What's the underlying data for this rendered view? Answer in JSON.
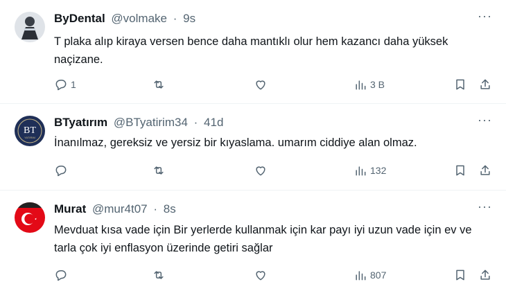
{
  "tweets": [
    {
      "name": "ByDental",
      "handle": "@volmake",
      "time": "9s",
      "text": "T plaka alıp kiraya versen bence daha mantıklı olur hem kazancı daha yüksek naçizane.",
      "replies": "1",
      "retweets": "",
      "likes": "",
      "views": "3 B"
    },
    {
      "name": "BTyatırım",
      "handle": "@BTyatirim34",
      "time": "41d",
      "text": "İnanılmaz, gereksiz ve yersiz bir kıyaslama. umarım ciddiye alan olmaz.",
      "replies": "",
      "retweets": "",
      "likes": "",
      "views": "132",
      "avatar_text": "BT",
      "avatar_subtext": "YATIRIM"
    },
    {
      "name": "Murat",
      "handle": "@mur4t07",
      "time": "8s",
      "text": "Mevduat kısa vade için Bir yerlerde kullanmak için kar payı iyi uzun vade için ev ve tarla çok iyi enflasyon üzerinde getiri sağlar",
      "replies": "",
      "retweets": "",
      "likes": "",
      "views": "807"
    }
  ],
  "ui": {
    "separator": "·",
    "more_icon": "more-horizontal-icon"
  },
  "colors": {
    "text": "#0f1419",
    "secondary": "#536471",
    "border": "#eff3f4"
  }
}
